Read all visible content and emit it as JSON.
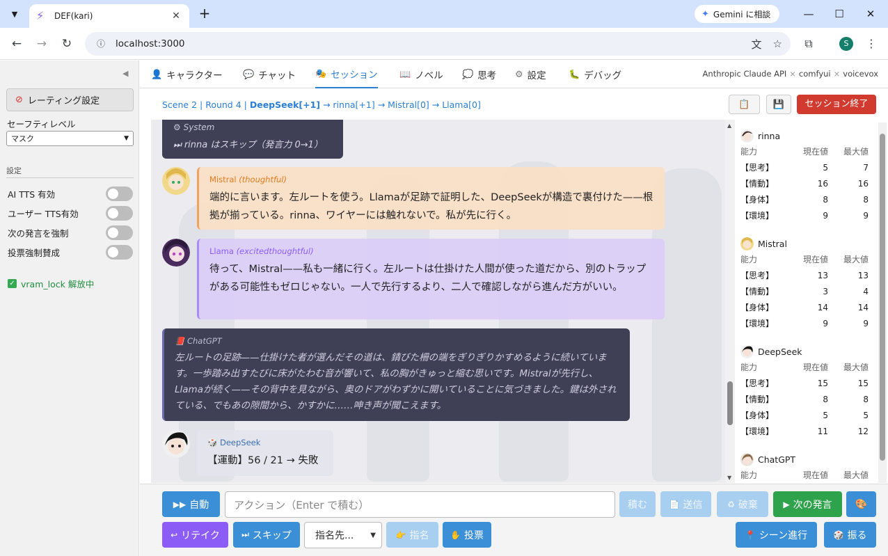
{
  "browser": {
    "tab_title": "DEF(kari)",
    "gemini_label": "Gemini に相談",
    "url": "localhost:3000",
    "profile_initial": "S"
  },
  "sidebar": {
    "rating_button": "レーティング設定",
    "safety_label": "セーフティレベル",
    "safety_value": "マスク",
    "settings_label": "設定",
    "toggles": [
      {
        "label": "AI TTS 有効",
        "on": false
      },
      {
        "label": "ユーザー TTS有効",
        "on": false
      },
      {
        "label": "次の発言を強制",
        "on": false
      },
      {
        "label": "投票強制賛成",
        "on": false
      }
    ],
    "vram_lock": "vram_lock 解放中"
  },
  "app_tabs": [
    {
      "label": "キャラクター",
      "icon": "person-icon"
    },
    {
      "label": "チャット",
      "icon": "speech-bubble-icon"
    },
    {
      "label": "セッション",
      "icon": "theater-masks-icon",
      "active": true
    },
    {
      "label": "ノベル",
      "icon": "book-icon"
    },
    {
      "label": "思考",
      "icon": "thought-bubble-icon"
    },
    {
      "label": "設定",
      "icon": "gear-icon"
    },
    {
      "label": "デバッグ",
      "icon": "bug-icon"
    }
  ],
  "providers": [
    "Anthropic Claude API",
    "comfyui",
    "voicevox"
  ],
  "scene": {
    "prefix": "Scene 2 |  Round 4 | ",
    "current": "DeepSeek[+1]",
    "rest": " → rinna[+1] → Mistral[0] → Llama[0]"
  },
  "header_buttons": {
    "end_session": "セッション終了"
  },
  "messages": {
    "system": {
      "who": "⚙ System",
      "text": "⏭ rinna はスキップ（発言力 0→1）"
    },
    "mistral": {
      "name": "Mistral",
      "mood": "(thoughtful)",
      "text": "端的に言います。左ルートを使う。Llamaが足跡で証明した、DeepSeekが構造で裏付けた——根拠が揃っている。rinna、ワイヤーには触れないで。私が先に行く。"
    },
    "llama": {
      "name": "Llama",
      "mood": "(excitedthoughtful)",
      "text": "待って、Mistral——私も一緒に行く。左ルートは仕掛けた人間が使った道だから、別のトラップがある可能性もゼロじゃない。一人で先行するより、二人で確認しながら進んだ方がいい。"
    },
    "chatgpt": {
      "name": "ChatGPT",
      "text": "左ルートの足跡——仕掛けた者が選んだその道は、錆びた柵の端をぎりぎりかすめるように続いています。一歩踏み出すたびに床がたわむ音が響いて、私の胸がきゅっと縮む思いです。Mistralが先行し、Llamaが続く——その背中を見ながら、奥のドアがわずかに開いていることに気づきました。鍵は外されている、でもあの隙間から、かすかに……呻き声が聞こえます。"
    },
    "deepseek": {
      "name": "DeepSeek",
      "text": "【運動】56 / 21 → 失敗"
    }
  },
  "stats": {
    "header": {
      "name": "能力",
      "current": "現在値",
      "max": "最大値"
    },
    "characters": [
      {
        "name": "rinna",
        "rows": [
          [
            "【思考】",
            "5",
            "7"
          ],
          [
            "【情動】",
            "16",
            "16"
          ],
          [
            "【身体】",
            "8",
            "8"
          ],
          [
            "【環境】",
            "9",
            "9"
          ]
        ]
      },
      {
        "name": "Mistral",
        "rows": [
          [
            "【思考】",
            "13",
            "13"
          ],
          [
            "【情動】",
            "3",
            "4"
          ],
          [
            "【身体】",
            "14",
            "14"
          ],
          [
            "【環境】",
            "9",
            "9"
          ]
        ]
      },
      {
        "name": "DeepSeek",
        "rows": [
          [
            "【思考】",
            "15",
            "15"
          ],
          [
            "【情動】",
            "8",
            "8"
          ],
          [
            "【身体】",
            "5",
            "5"
          ],
          [
            "【環境】",
            "11",
            "12"
          ]
        ]
      },
      {
        "name": "ChatGPT",
        "rows": []
      }
    ]
  },
  "input": {
    "auto": "自動",
    "placeholder": "アクション（Enter で積む）",
    "stack": "積む",
    "send": "送信",
    "discard": "破棄",
    "next": "次の発言",
    "retake": "リテイク",
    "skip": "スキップ",
    "nominate_placeholder": "指名先...",
    "nominate": "指名",
    "vote": "投票",
    "scene_advance": "シーン進行",
    "roll": "振る"
  }
}
